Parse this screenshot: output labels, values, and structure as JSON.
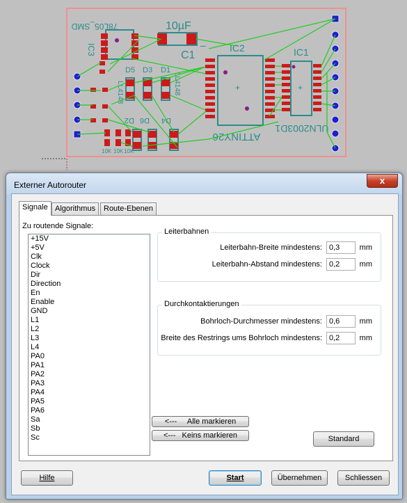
{
  "pcb": {
    "labels": {
      "ic3": "IC3",
      "reg": "78L05_SMD",
      "cap_value": "10µF",
      "cap_name": "C1",
      "minus": "–",
      "ic2": "IC2",
      "ic2_value": "ATTINY26",
      "ic1": "IC1",
      "ic1_value": "ULN2003D1",
      "d1": "D1",
      "d2": "D2",
      "d3": "D3",
      "d4": "D4",
      "d5": "D5",
      "d6": "D6",
      "ll4148a": "LL4148",
      "ll4148b": "LL4148",
      "r1": "10K",
      "r2": "10K",
      "r3": "10K"
    }
  },
  "dialog": {
    "title": "Externer Autorouter",
    "close_glyph": "x",
    "tabs": [
      "Signale",
      "Algorithmus",
      "Route-Ebenen"
    ],
    "signals_label": "Zu routende Signale:",
    "signals": [
      "+15V",
      "+5V",
      "Clk",
      "Clock",
      "Dir",
      "Direction",
      "En",
      "Enable",
      "GND",
      "L1",
      "L2",
      "L3",
      "L4",
      "PA0",
      "PA1",
      "PA2",
      "PA3",
      "PA4",
      "PA5",
      "PA6",
      "Sa",
      "Sb",
      "Sc"
    ],
    "traces_group": {
      "title": "Leiterbahnen",
      "width_label": "Leiterbahn-Breite mindestens:",
      "width_value": "0,3",
      "spacing_label": "Leiterbahn-Abstand mindestens:",
      "spacing_value": "0,2",
      "unit": "mm"
    },
    "vias_group": {
      "title": "Durchkontaktierungen",
      "drill_label": "Bohrloch-Durchmesser mindestens:",
      "drill_value": "0,6",
      "ring_label": "Breite des Restrings ums Bohrloch mindestens:",
      "ring_value": "0,2",
      "unit": "mm"
    },
    "mark_all": "<---     Alle markieren",
    "mark_none": "<---   Keins markieren",
    "standard": "Standard",
    "help": "Hilfe",
    "start": "Start",
    "apply": "Übernehmen",
    "close": "Schliessen"
  },
  "colors": {
    "board_outline": "#ff8080",
    "trace": "#22cc22",
    "pad": "#cc1a1a",
    "pin": "#1f1fcc",
    "silkscreen": "#2e8b8b",
    "annotation_arrow": "#e8161c"
  }
}
